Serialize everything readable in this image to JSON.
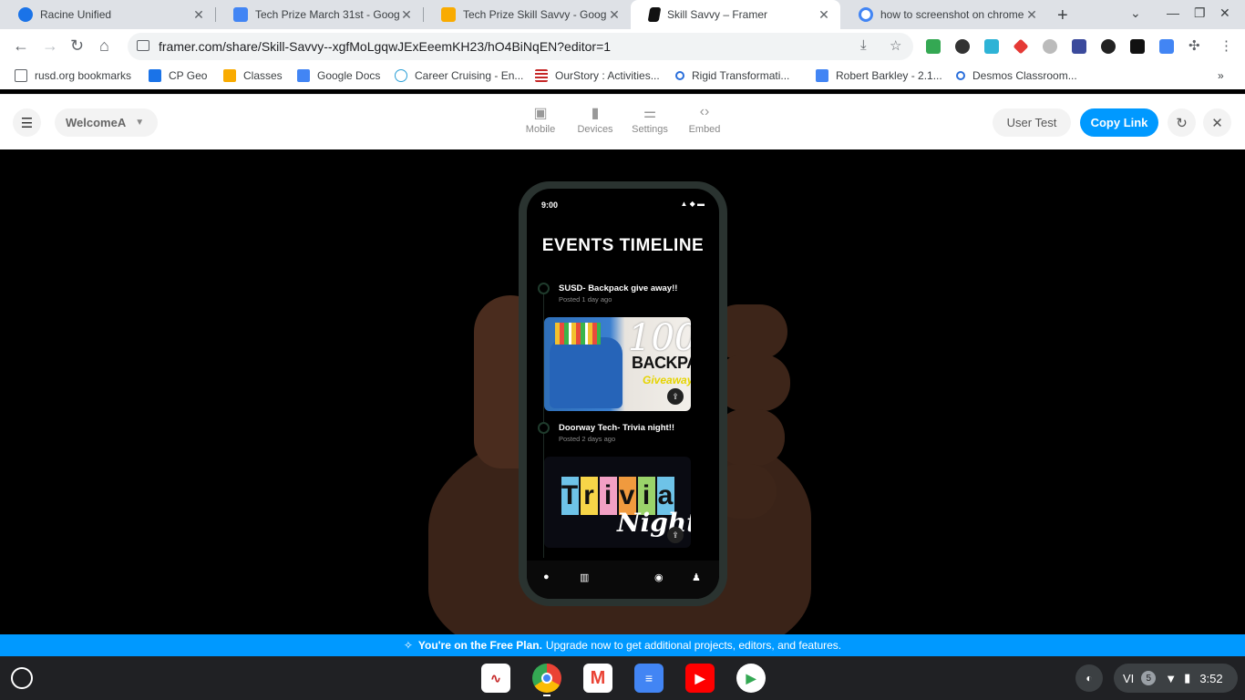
{
  "browser": {
    "tabs": [
      {
        "title": "Racine Unified",
        "favicon_color": "#1a73e8"
      },
      {
        "title": "Tech Prize March 31st - Google",
        "favicon_color": "#4285f4"
      },
      {
        "title": "Tech Prize Skill Savvy - Google",
        "favicon_color": "#f9ab00"
      },
      {
        "title": "Skill Savvy – Framer",
        "favicon_color": "#111111",
        "active": true
      },
      {
        "title": "how to screenshot on chrome",
        "favicon_color": "#ffffff"
      }
    ],
    "url": "framer.com/share/Skill-Savvy--xgfMoLgqwJExEeemKH23/hO4BiNqEN?editor=1",
    "bookmarks": [
      {
        "label": "rusd.org bookmarks",
        "color": "#5f6368"
      },
      {
        "label": "CP Geo",
        "color": "#1a73e8"
      },
      {
        "label": "Classes",
        "color": "#f9ab00"
      },
      {
        "label": "Google Docs",
        "color": "#4285f4"
      },
      {
        "label": "Career Cruising - En...",
        "color": "#2a9fd6"
      },
      {
        "label": "OurStory : Activities...",
        "color": "#c62828"
      },
      {
        "label": "Rigid Transformati...",
        "color": "#2a6fdb"
      },
      {
        "label": "Robert Barkley - 2.1...",
        "color": "#4285f4"
      },
      {
        "label": "Desmos Classroom...",
        "color": "#2a6fdb"
      }
    ]
  },
  "framer": {
    "page_selector": "WelcomeA",
    "tools": [
      {
        "label": "Mobile",
        "icon": "phone-frame-icon"
      },
      {
        "label": "Devices",
        "icon": "devices-icon"
      },
      {
        "label": "Settings",
        "icon": "sliders-icon"
      },
      {
        "label": "Embed",
        "icon": "code-icon"
      }
    ],
    "user_test": "User Test",
    "copy_link": "Copy Link",
    "accent": "#0099ff"
  },
  "phone": {
    "time": "9:00",
    "title": "EVENTS TIMELINE",
    "events": [
      {
        "title": "SUSD- Backpack give away!!",
        "posted": "Posted 1 day ago",
        "image_text": [
          "100",
          "BACKPACK",
          "Giveaway"
        ]
      },
      {
        "title": "Doorway Tech-  Trivia night!!",
        "posted": "Posted 2 days ago",
        "image_text": [
          "Trivia",
          "Night"
        ]
      }
    ],
    "trivia_colors": [
      "#6ec3e8",
      "#f7d548",
      "#f2a0c4",
      "#f09a3e",
      "#9ad36a",
      "#6ec3e8"
    ]
  },
  "banner": {
    "bold": "You're on the Free Plan.",
    "text": "Upgrade now to get additional projects, editors, and features."
  },
  "shelf": {
    "apps": [
      {
        "name": "sine-app-icon",
        "color": "#ffffff"
      },
      {
        "name": "chrome-icon",
        "color": "#4285f4"
      },
      {
        "name": "gmail-icon",
        "color": "#ea4335"
      },
      {
        "name": "docs-icon",
        "color": "#4285f4"
      },
      {
        "name": "youtube-icon",
        "color": "#ff0000"
      },
      {
        "name": "play-store-icon",
        "color": "#ffffff"
      }
    ],
    "ime": "VI",
    "notifications": "5",
    "clock": "3:52"
  }
}
